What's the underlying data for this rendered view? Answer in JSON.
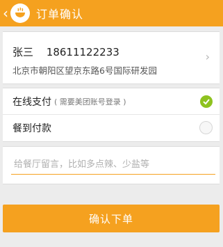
{
  "header": {
    "back_icon": "chevron-left-icon",
    "logo_icon": "bowl-logo-icon",
    "title": "订单确认"
  },
  "address": {
    "name": "张三",
    "phone": "18611122233",
    "address": "北京市朝阳区望京东路6号国际研发园",
    "chevron": "›"
  },
  "payment": {
    "online_label": "在线支付",
    "online_note": "( 需要美团账号登录 )",
    "online_selected": true,
    "cash_label": "餐到付款",
    "cash_selected": false,
    "selected_color": "#8ec21f"
  },
  "message": {
    "placeholder": "给餐厅留言，比如多点辣、少盐等",
    "value": ""
  },
  "confirm_button": {
    "label": "确认下单",
    "color": "#f5a11f"
  },
  "accent_color": "#f5a11f"
}
